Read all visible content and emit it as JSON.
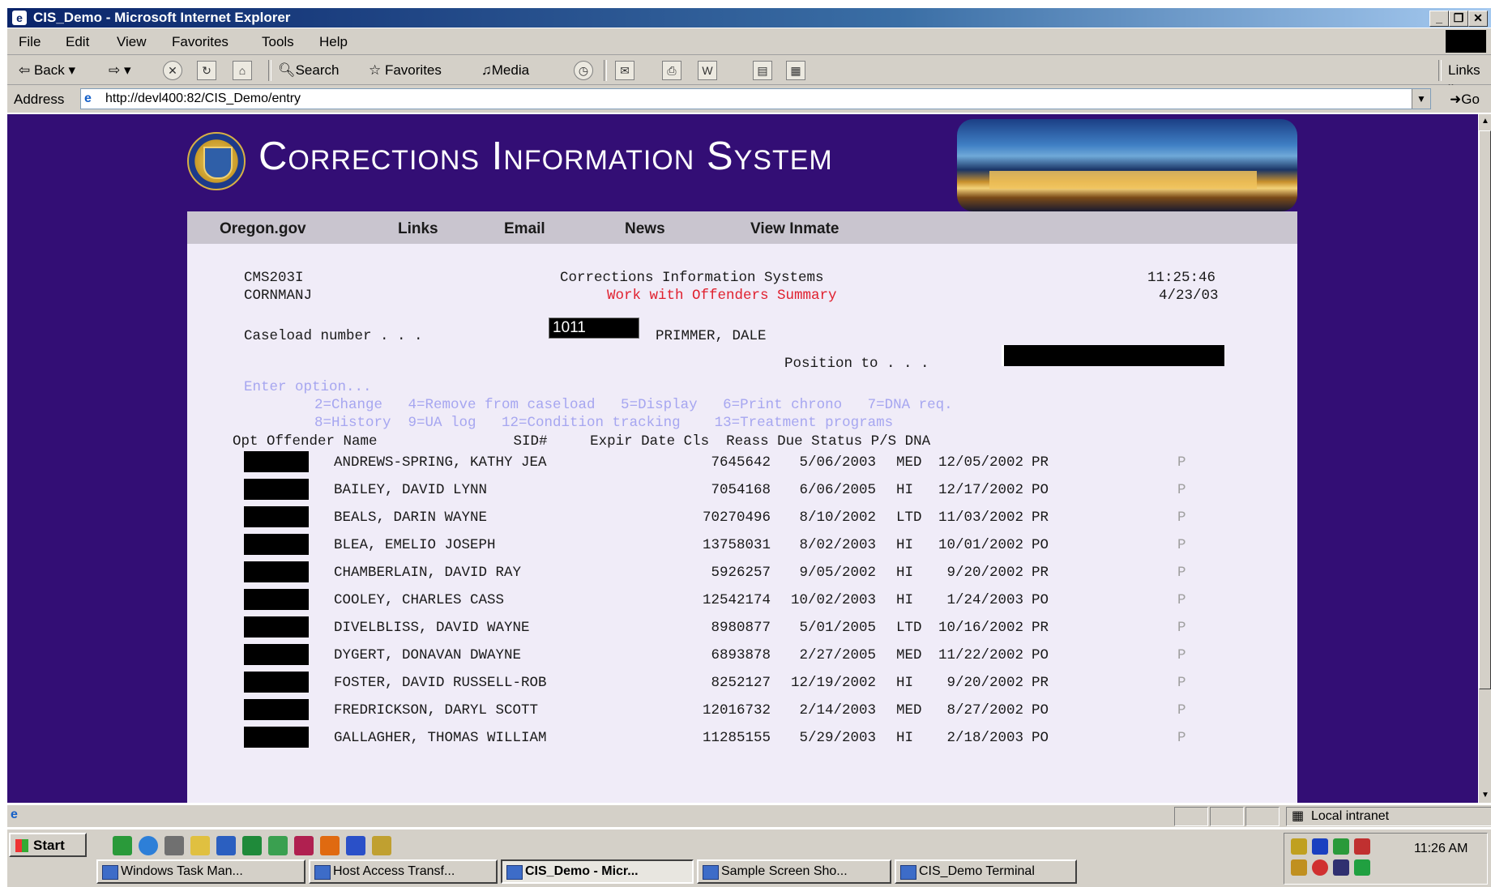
{
  "window": {
    "title": "CIS_Demo - Microsoft Internet Explorer"
  },
  "menu": [
    "File",
    "Edit",
    "View",
    "Favorites",
    "Tools",
    "Help"
  ],
  "toolbar": {
    "back": "Back",
    "search": "Search",
    "favorites": "Favorites",
    "media": "Media",
    "links": "Links"
  },
  "address": {
    "label": "Address",
    "url": "http://devl400:82/CIS_Demo/entry",
    "go": "Go"
  },
  "banner": {
    "title": "Corrections Information System"
  },
  "nav": [
    "Oregon.gov",
    "Links",
    "Email",
    "News",
    "View Inmate"
  ],
  "screen": {
    "program": "CMS203I",
    "user": "CORNMANJ",
    "system_title": "Corrections Information Systems",
    "subtitle": "Work with Offenders Summary",
    "time": "11:25:46",
    "date": "4/23/03",
    "caseload_label": "Caseload number . . .",
    "caseload_value": "1011",
    "caseload_officer": "PRIMMER, DALE",
    "position_label": "Position to . . .",
    "position_value": "",
    "enter_option": "Enter option...",
    "options_line1": "2=Change   4=Remove from caseload   5=Display   6=Print chrono   7=DNA req.",
    "options_line2": "8=History  9=UA log   12=Condition tracking    13=Treatment programs",
    "columns": "Opt Offender Name                SID#     Expir Date Cls  Reass Due Status P/S DNA"
  },
  "rows": [
    {
      "name": "ANDREWS-SPRING, KATHY JEA",
      "sid": "7645642",
      "expir": "5/06/2003",
      "cls": "MED",
      "reass": "12/05/2002",
      "status": "PR",
      "dna": "P"
    },
    {
      "name": "BAILEY, DAVID LYNN",
      "sid": "7054168",
      "expir": "6/06/2005",
      "cls": "HI",
      "reass": "12/17/2002",
      "status": "PO",
      "dna": "P"
    },
    {
      "name": "BEALS, DARIN WAYNE",
      "sid": "70270496",
      "expir": "8/10/2002",
      "cls": "LTD",
      "reass": "11/03/2002",
      "status": "PR",
      "dna": "P"
    },
    {
      "name": "BLEA, EMELIO JOSEPH",
      "sid": "13758031",
      "expir": "8/02/2003",
      "cls": "HI",
      "reass": "10/01/2002",
      "status": "PO",
      "dna": "P"
    },
    {
      "name": "CHAMBERLAIN, DAVID RAY",
      "sid": "5926257",
      "expir": "9/05/2002",
      "cls": "HI",
      "reass": "9/20/2002",
      "status": "PR",
      "dna": "P"
    },
    {
      "name": "COOLEY, CHARLES CASS",
      "sid": "12542174",
      "expir": "10/02/2003",
      "cls": "HI",
      "reass": "1/24/2003",
      "status": "PO",
      "dna": "P"
    },
    {
      "name": "DIVELBLISS, DAVID WAYNE",
      "sid": "8980877",
      "expir": "5/01/2005",
      "cls": "LTD",
      "reass": "10/16/2002",
      "status": "PR",
      "dna": "P"
    },
    {
      "name": "DYGERT, DONAVAN DWAYNE",
      "sid": "6893878",
      "expir": "2/27/2005",
      "cls": "MED",
      "reass": "11/22/2002",
      "status": "PO",
      "dna": "P"
    },
    {
      "name": "FOSTER, DAVID RUSSELL-ROB",
      "sid": "8252127",
      "expir": "12/19/2002",
      "cls": "HI",
      "reass": "9/20/2002",
      "status": "PR",
      "dna": "P"
    },
    {
      "name": "FREDRICKSON, DARYL SCOTT",
      "sid": "12016732",
      "expir": "2/14/2003",
      "cls": "MED",
      "reass": "8/27/2002",
      "status": "PO",
      "dna": "P"
    },
    {
      "name": "GALLAGHER, THOMAS WILLIAM",
      "sid": "11285155",
      "expir": "5/29/2003",
      "cls": "HI",
      "reass": "2/18/2003",
      "status": "PO",
      "dna": "P"
    }
  ],
  "status": {
    "zone": "Local intranet"
  },
  "taskbar": {
    "start": "Start",
    "tasks": [
      "Windows Task Man...",
      "Host Access Transf...",
      "CIS_Demo - Micr...",
      "Sample Screen Sho...",
      "CIS_Demo Terminal"
    ],
    "clock": "11:26 AM"
  }
}
